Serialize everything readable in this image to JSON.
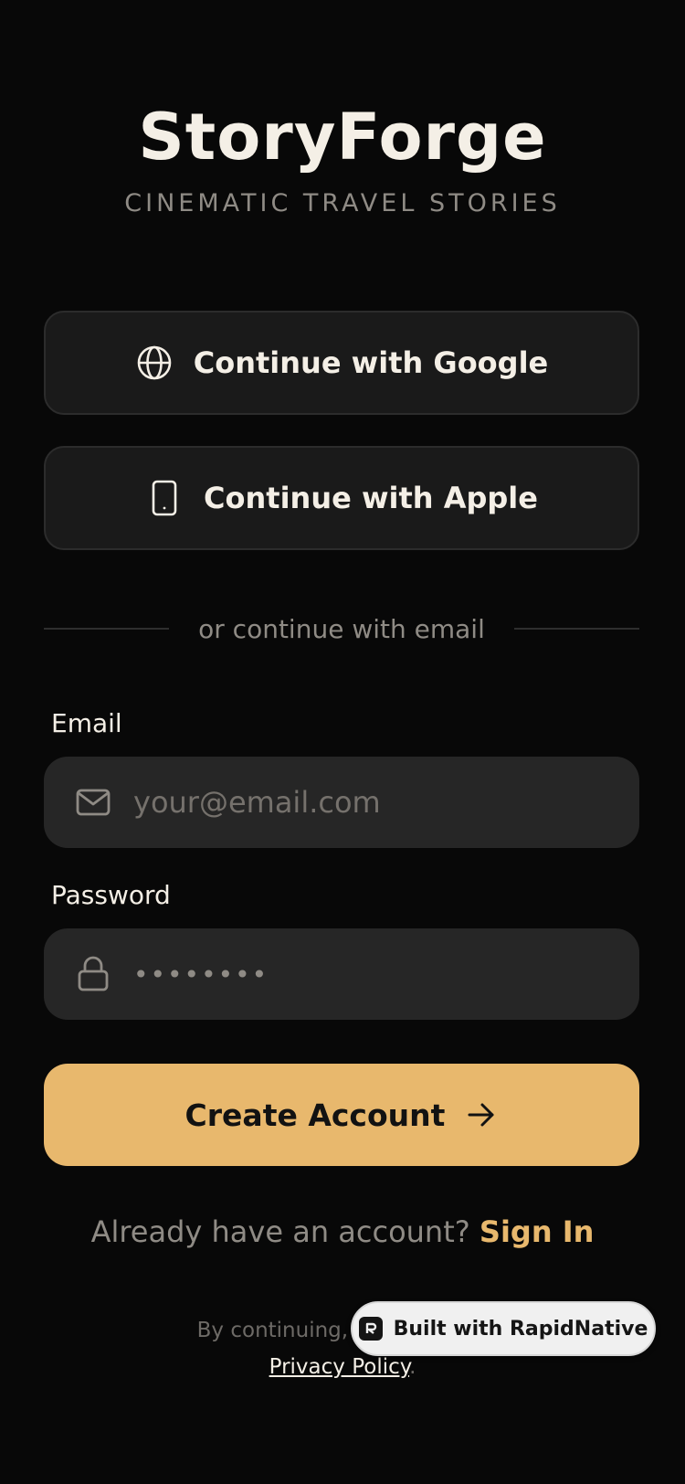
{
  "brand": {
    "title": "StoryForge",
    "tagline": "CINEMATIC TRAVEL STORIES"
  },
  "social": {
    "google_label": "Continue with Google",
    "apple_label": "Continue with Apple",
    "google_icon": "globe-icon",
    "apple_icon": "phone-icon"
  },
  "divider": {
    "text": "or continue with email"
  },
  "form": {
    "email_label": "Email",
    "email_placeholder": "your@email.com",
    "email_value": "",
    "email_icon": "mail-icon",
    "password_label": "Password",
    "password_display": "••••••••",
    "password_icon": "lock-icon",
    "submit_label": "Create Account",
    "submit_icon": "arrow-right-icon"
  },
  "signin": {
    "prompt": "Already have an account? ",
    "link": "Sign In"
  },
  "legal": {
    "prefix": "By continuing, you agree to",
    "link": "Privacy Policy",
    "suffix": "."
  },
  "badge": {
    "label": "Built with RapidNative",
    "icon": "rapidnative-logo-icon"
  },
  "colors": {
    "background": "#080808",
    "accent": "#e8b86d",
    "surface": "#1a1a1a",
    "input": "#262626",
    "text": "#f4efe6",
    "muted": "#8f8b85"
  }
}
